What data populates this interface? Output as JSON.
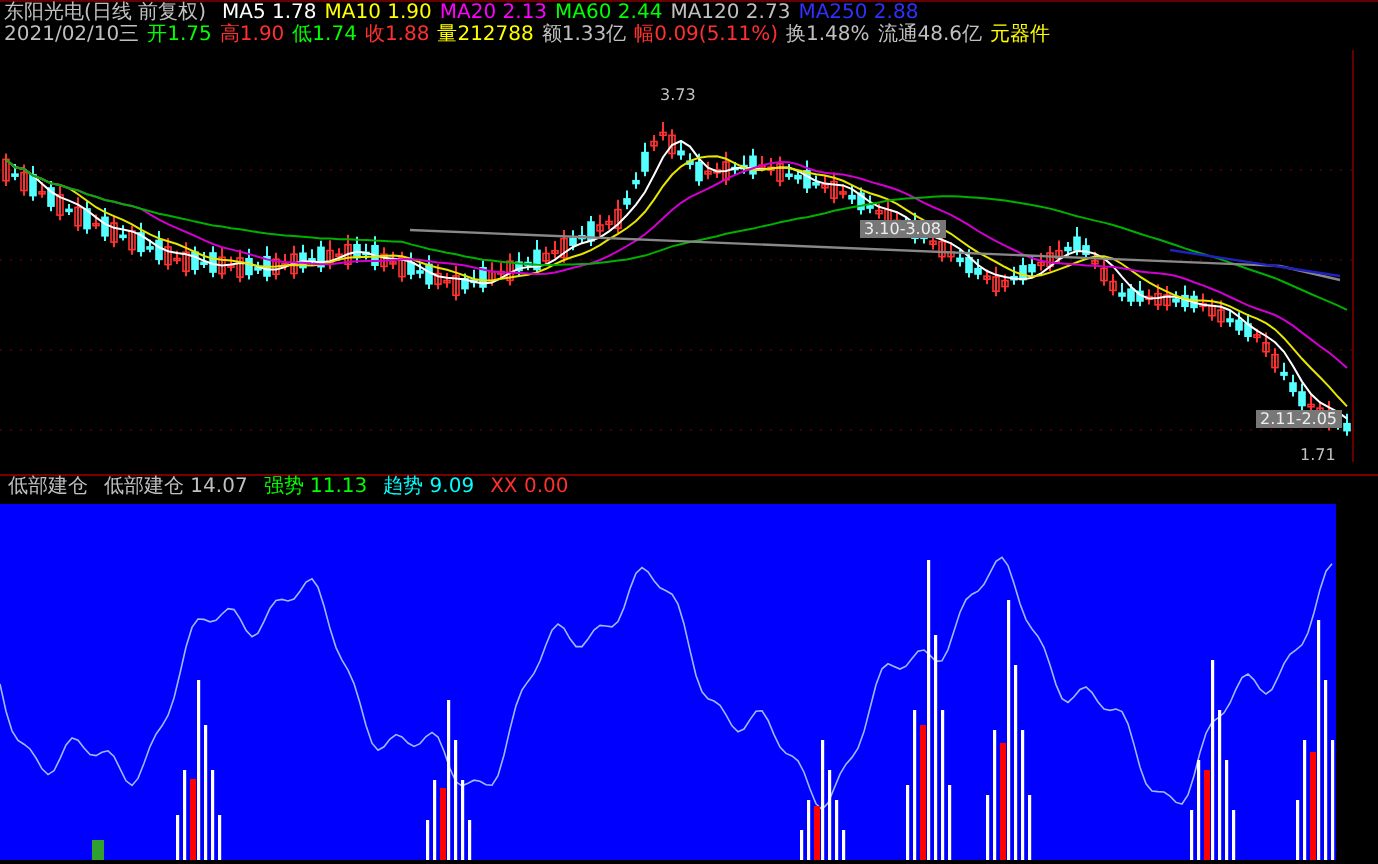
{
  "chart": {
    "title": "东阳光电(日线 前复权)",
    "ma": [
      {
        "label": "MA5",
        "value": "1.78",
        "color": "#ffffff"
      },
      {
        "label": "MA10",
        "value": "1.90",
        "color": "#ffff00"
      },
      {
        "label": "MA20",
        "value": "2.13",
        "color": "#ff00ff"
      },
      {
        "label": "MA60",
        "value": "2.44",
        "color": "#00ff00"
      },
      {
        "label": "MA120",
        "value": "2.73",
        "color": "#c0c0c0"
      },
      {
        "label": "MA250",
        "value": "2.88",
        "color": "#3030ff"
      }
    ],
    "quote": [
      {
        "label": "2021/02/10三",
        "color": "#c0c0c0"
      },
      {
        "label": "开",
        "value": "1.75",
        "color": "#00ff00"
      },
      {
        "label": "高",
        "value": "1.90",
        "color": "#ff3030"
      },
      {
        "label": "低",
        "value": "1.74",
        "color": "#00ff00"
      },
      {
        "label": "收",
        "value": "1.88",
        "color": "#ff3030"
      },
      {
        "label": "量",
        "value": "212788",
        "color": "#ffff00"
      },
      {
        "label": "额",
        "value": "1.33亿",
        "color": "#c0c0c0"
      },
      {
        "label": "幅",
        "value": "0.09(5.11%)",
        "color": "#ff3030"
      },
      {
        "label": "换",
        "value": "1.48%",
        "color": "#c0c0c0"
      },
      {
        "label": "流通",
        "value": "48.6亿",
        "color": "#c0c0c0"
      },
      {
        "label": "元器件",
        "color": "#ffff00"
      }
    ],
    "price_marks": [
      {
        "text": "3.73",
        "kind": "high"
      },
      {
        "text": "3.10-3.08",
        "kind": "gap"
      },
      {
        "text": "2.11-2.05",
        "kind": "gap"
      },
      {
        "text": "1.71",
        "kind": "low"
      }
    ]
  },
  "indicator": {
    "name": "低部建仓",
    "formula": "低部建仓",
    "value": "14.07",
    "items": [
      {
        "label": "强势",
        "value": "11.13",
        "color": "#00ff00"
      },
      {
        "label": "趋势",
        "value": "9.09",
        "color": "#00ffff"
      },
      {
        "label": "XX",
        "value": "0.00",
        "color": "#ff3030"
      }
    ]
  }
}
